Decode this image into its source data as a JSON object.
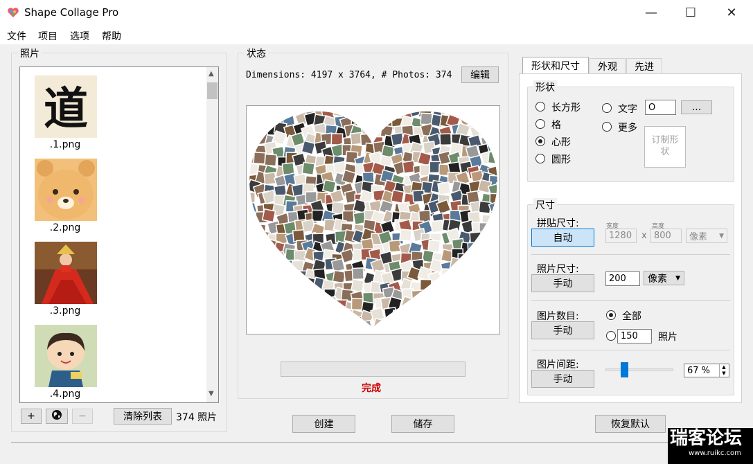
{
  "window": {
    "title": "Shape Collage Pro",
    "minimize_glyph": "—",
    "maximize_glyph": "☐",
    "close_glyph": "✕"
  },
  "menu": [
    "文件",
    "项目",
    "选项",
    "帮助"
  ],
  "photos_panel": {
    "legend": "照片",
    "items": [
      {
        "label": ".1.png",
        "icon": "calligraphy-thumbnail"
      },
      {
        "label": ".2.png",
        "icon": "bear-thumbnail"
      },
      {
        "label": ".3.png",
        "icon": "red-dress-thumbnail"
      },
      {
        "label": ".4.png",
        "icon": "cartoon-boy-thumbnail"
      }
    ],
    "add_label": "+",
    "web_icon": "globe-icon",
    "remove_label": "−",
    "clear_label": "清除列表",
    "count_text": "374 照片"
  },
  "status_panel": {
    "legend": "状态",
    "dimensions_text": "Dimensions: 4197 x 3764, # Photos: 374",
    "edit_label": "编辑",
    "status_text": "完成",
    "status_color": "#cc0000"
  },
  "actions": {
    "create_label": "创建",
    "save_label": "储存",
    "reset_label": "恢复默认"
  },
  "tabs": [
    "形状和尺寸",
    "外观",
    "先进"
  ],
  "shape": {
    "legend": "形状",
    "options": [
      "长方形",
      "格",
      "心形",
      "圆形"
    ],
    "selected": "心形",
    "text_label": "文字",
    "text_value": "O",
    "browse_label": "...",
    "more_label": "更多",
    "custom_label_line1": "订制形",
    "custom_label_line2": "状"
  },
  "size": {
    "legend": "尺寸",
    "collage_size_label": "拼贴尺寸:",
    "collage_mode": "自动",
    "width_caption": "宽度",
    "height_caption": "高度",
    "width_value": "1280",
    "height_value": "800",
    "x_sep": "x",
    "collage_unit": "像素",
    "photo_size_label": "照片尺寸:",
    "photo_mode": "手动",
    "photo_size_value": "200",
    "photo_unit": "像素",
    "count_label": "图片数目:",
    "count_mode": "手动",
    "count_all_label": "全部",
    "count_value": "150",
    "count_unit": "照片",
    "spacing_label": "图片间距:",
    "spacing_mode": "手动",
    "spacing_value": "67 %",
    "spacing_level_percent": 25
  },
  "watermark": {
    "line1": "瑞客论坛",
    "line2": "www.ruikc.com"
  }
}
